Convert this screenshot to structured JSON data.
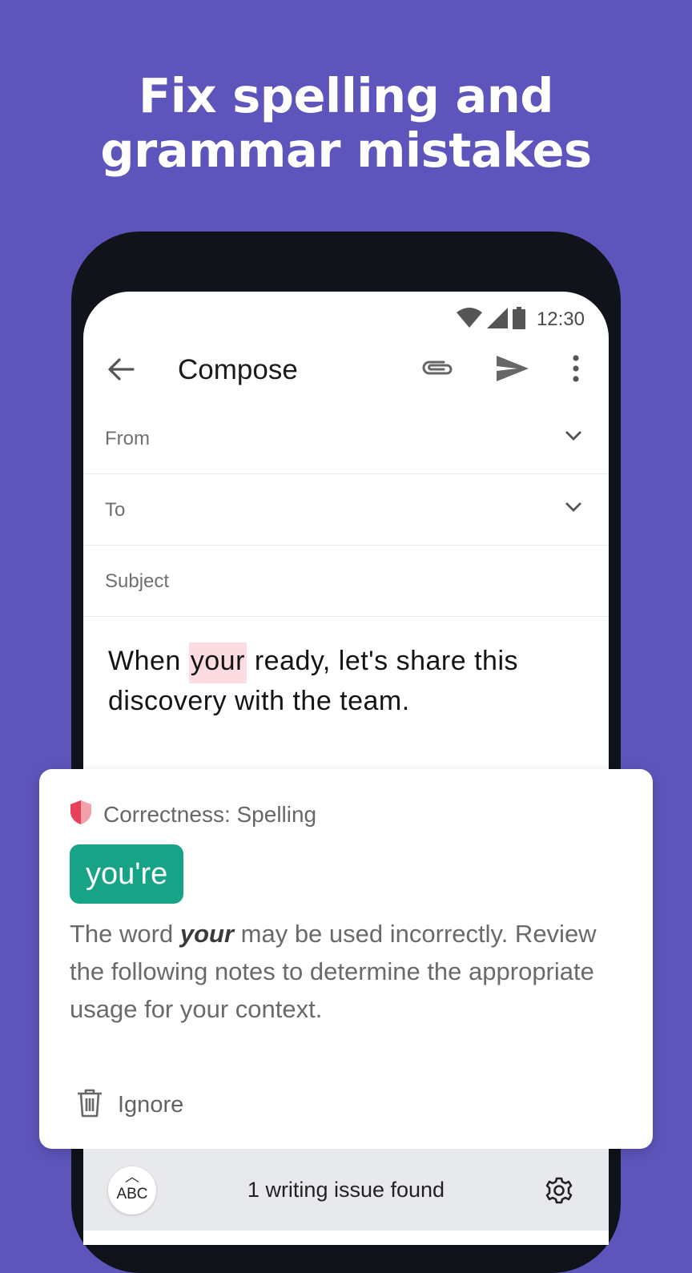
{
  "headline": {
    "line1": "Fix spelling and",
    "line2": "grammar mistakes"
  },
  "status_bar": {
    "time": "12:30",
    "icons": [
      "wifi-icon",
      "signal-icon",
      "battery-icon"
    ]
  },
  "app_bar": {
    "title": "Compose",
    "icons": [
      "back-arrow-icon",
      "attachment-icon",
      "send-icon",
      "more-vert-icon"
    ]
  },
  "fields": {
    "from": "From",
    "to": "To",
    "subject": "Subject"
  },
  "body": {
    "before": "When ",
    "highlight": "your",
    "after": " ready, let's share this discovery with the team."
  },
  "card": {
    "category": "Correctness: Spelling",
    "suggestion": "you're",
    "explain_pre": "The word ",
    "explain_word": "your",
    "explain_post": " may be used incorrectly. Review the following notes to determine the appropriate usage for your context.",
    "ignore_label": "Ignore"
  },
  "bottom_bar": {
    "abc_label": "ABC",
    "status": "1 writing issue found"
  },
  "colors": {
    "background": "#5d55bb",
    "accent": "#16a386",
    "highlight": "#fbdde1",
    "alert": "#e8425a"
  }
}
